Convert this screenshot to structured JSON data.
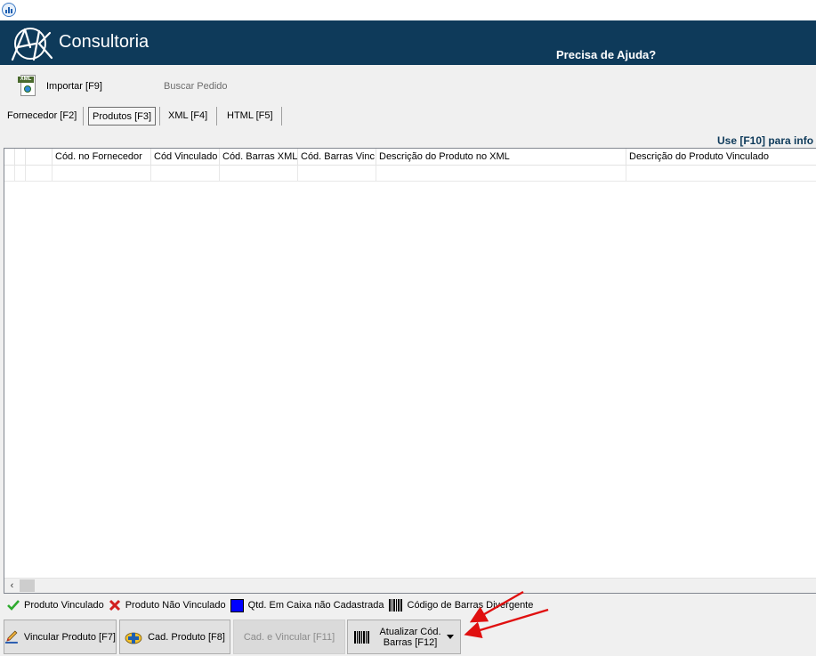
{
  "banner": {
    "logo_text": "Consultoria",
    "help_link": "Precisa de Ajuda?",
    "background_color": "#0e3a5a"
  },
  "toolbar": {
    "import_label": "Importar [F9]",
    "import_icon": "xml-file-icon",
    "import_icon_tag": "XML",
    "search_order_label": "Buscar Pedido"
  },
  "tabs": [
    {
      "label": "Fornecedor [F2]",
      "active": false
    },
    {
      "label": "Produtos [F3]",
      "active": true
    },
    {
      "label": "XML [F4]",
      "active": false
    },
    {
      "label": "HTML [F5]",
      "active": false
    }
  ],
  "hint": "Use [F10] para info",
  "grid": {
    "columns": [
      "",
      "",
      "",
      "Cód. no Fornecedor",
      "Cód Vinculado",
      "Cód. Barras XML",
      "Cód. Barras Vinc.",
      "Descrição do Produto no XML",
      "Descrição do Produto Vinculado"
    ],
    "rows": [],
    "scroll_left_glyph": "‹"
  },
  "legend": [
    {
      "icon": "check-icon",
      "label": "Produto Vinculado",
      "color": "#2eaa2e"
    },
    {
      "icon": "cross-icon",
      "label": "Produto Não Vinculado",
      "color": "#d21f1f"
    },
    {
      "icon": "blue-square-icon",
      "label": "Qtd. Em Caixa não Cadastrada",
      "color": "#0000ff"
    },
    {
      "icon": "barcode-icon",
      "label": "Código de Barras Divergente",
      "color": "#000000"
    }
  ],
  "buttons": {
    "vincular": "Vincular Produto [F7]",
    "cadastrar": "Cad. Produto [F8]",
    "cad_vincular": "Cad. e Vincular [F11]",
    "atualizar_line1": "Atualizar Cód.",
    "atualizar_line2": "Barras [F12]"
  },
  "annotation_color": "#e01010"
}
